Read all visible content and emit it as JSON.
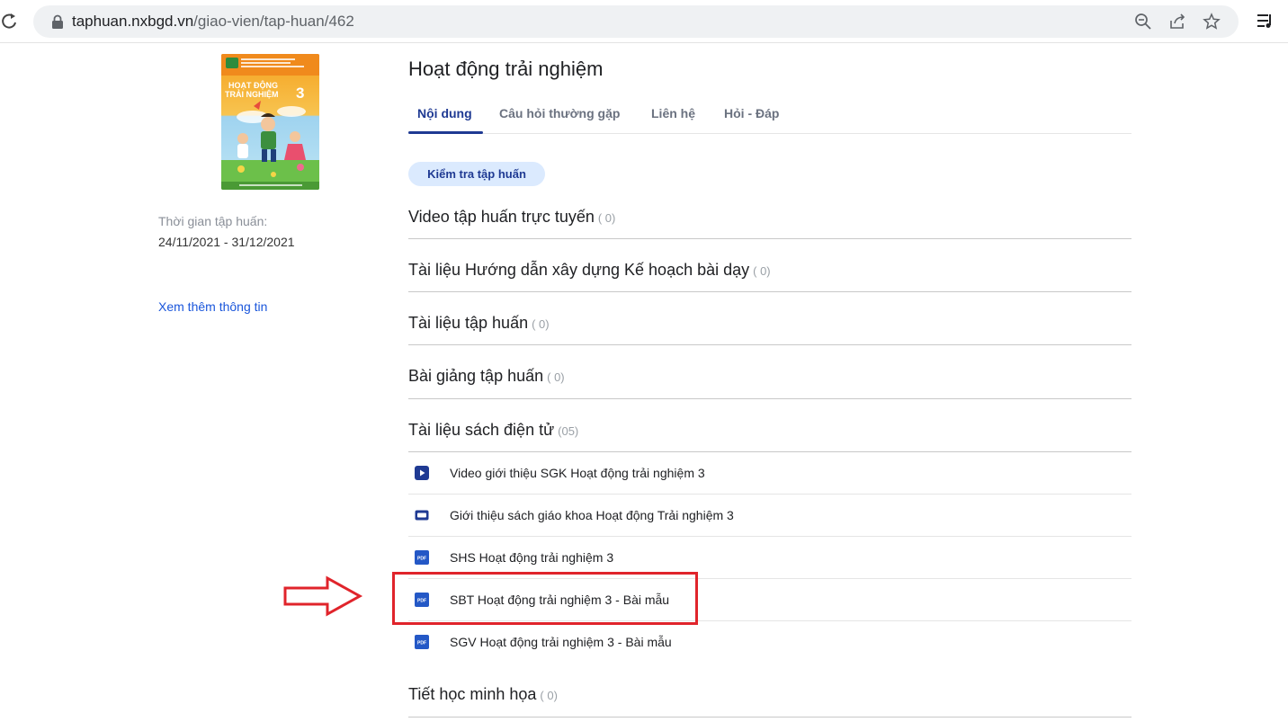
{
  "browser": {
    "url_host": "taphuan.nxbgd.vn",
    "url_path": "/giao-vien/tap-huan/462",
    "icons": [
      "reload-icon",
      "lock-icon",
      "zoom-out-icon",
      "share-icon",
      "star-icon",
      "reading-list-icon"
    ]
  },
  "sidebar": {
    "cover_title_line1": "HOẠT ĐỘNG",
    "cover_title_line2": "TRẢI NGHIỆM",
    "cover_grade": "3",
    "time_label": "Thời gian tập huấn:",
    "time_value": "24/11/2021 - 31/12/2021",
    "more_link": "Xem thêm thông tin"
  },
  "main": {
    "title": "Hoạt động trải nghiệm",
    "tabs": [
      {
        "label": "Nội dung",
        "active": true
      },
      {
        "label": "Câu hỏi thường gặp",
        "active": false
      },
      {
        "label": "Liên hệ",
        "active": false
      },
      {
        "label": "Hỏi - Đáp",
        "active": false
      }
    ],
    "check_button": "Kiểm tra tập huấn",
    "sections": [
      {
        "title": "Video tập huấn trực tuyến",
        "count": "( 0)"
      },
      {
        "title": "Tài liệu Hướng dẫn xây dựng Kế hoạch bài dạy",
        "count": "( 0)"
      },
      {
        "title": "Tài liệu tập huấn",
        "count": "( 0)"
      },
      {
        "title": "Bài giảng tập huấn",
        "count": "( 0)"
      },
      {
        "title": "Tài liệu sách điện tử",
        "count": "(05)"
      },
      {
        "title": "Tiết học minh họa",
        "count": "( 0)"
      }
    ],
    "ebook_items": [
      {
        "label": "Video giới thiệu SGK Hoạt động trải nghiệm 3",
        "icon": "video-play-icon"
      },
      {
        "label": "Giới thiệu sách giáo khoa Hoạt động Trải nghiệm 3",
        "icon": "slideshow-icon"
      },
      {
        "label": "SHS Hoạt động trải nghiệm 3",
        "icon": "pdf-icon"
      },
      {
        "label": "SBT Hoạt động trải nghiệm 3 - Bài mẫu",
        "icon": "pdf-icon"
      },
      {
        "label": "SGV Hoạt động trải nghiệm 3 - Bài mẫu",
        "icon": "pdf-icon"
      }
    ],
    "pdf_badge": "PDF"
  },
  "colors": {
    "accent": "#1f3a93",
    "link": "#1a56db",
    "annotation": "#e0242b",
    "button_bg": "#dbeafe"
  }
}
